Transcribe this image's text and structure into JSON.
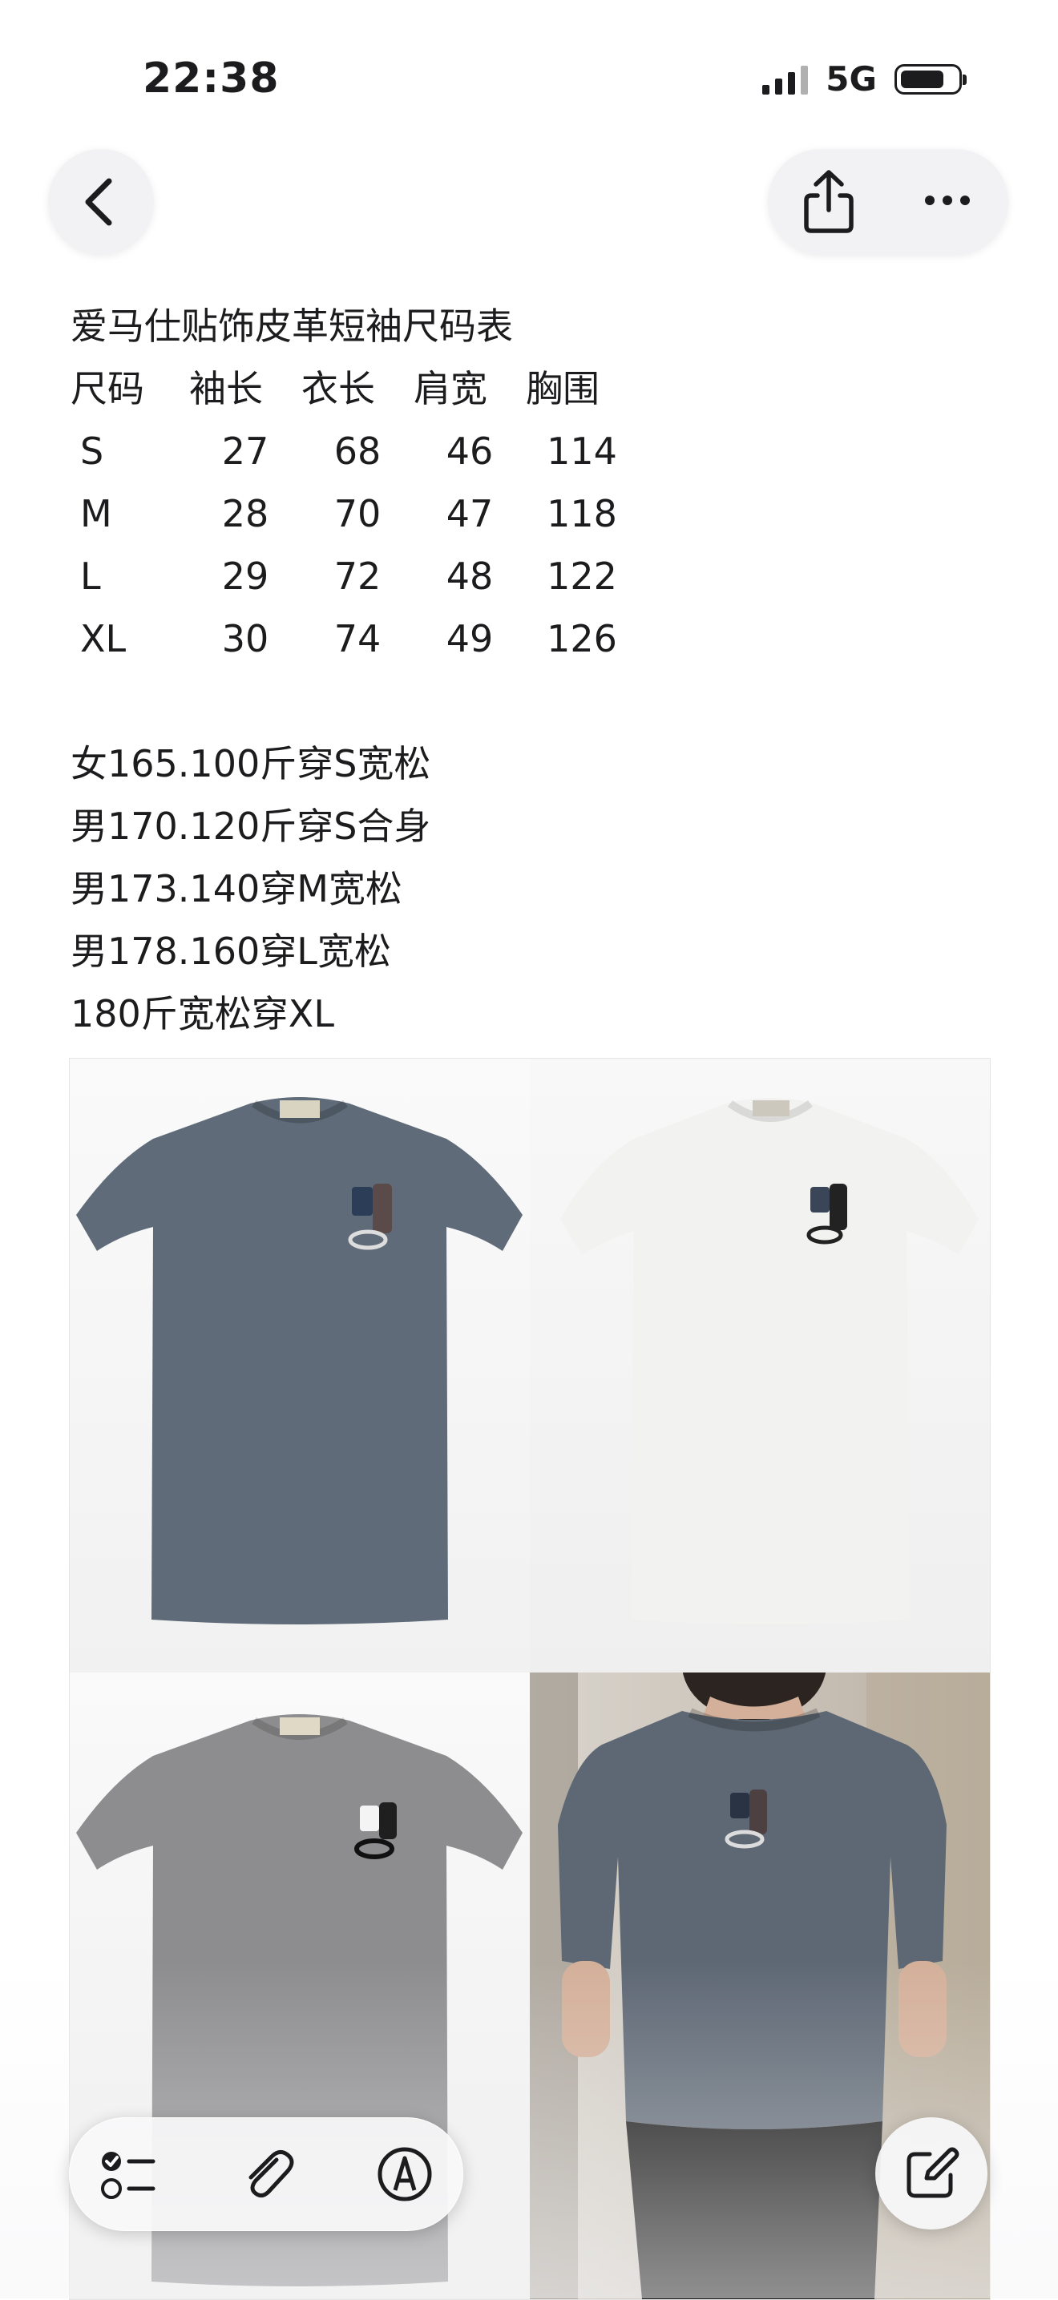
{
  "status_bar": {
    "time": "22:38",
    "network": "5G",
    "battery_level": 0.75
  },
  "toolbar": {
    "back_icon": "chevron-left-icon",
    "share_icon": "share-icon",
    "more_icon": "ellipsis-icon"
  },
  "note": {
    "title": "爱马仕贴饰皮革短袖尺码表",
    "size_table": {
      "headers": [
        "尺码",
        "袖长",
        "衣长",
        "肩宽",
        "胸围"
      ],
      "rows": [
        [
          "S",
          "27",
          "68",
          "46",
          "114"
        ],
        [
          "M",
          "28",
          "70",
          "47",
          "118"
        ],
        [
          "L",
          "29",
          "72",
          "48",
          "122"
        ],
        [
          "XL",
          "30",
          "74",
          "49",
          "126"
        ]
      ]
    },
    "fit_guide": [
      "女165.100斤穿S宽松",
      "男170.120斤穿S合身",
      "男173.140穿M宽松",
      "男178.160穿L宽松",
      "180斤宽松穿XL"
    ]
  },
  "photos": [
    {
      "name": "dark-grey-tshirt",
      "color": "#5f6b78"
    },
    {
      "name": "white-tshirt",
      "color": "#f2f2f0"
    },
    {
      "name": "light-grey-tshirt",
      "color": "#8d8d8f"
    },
    {
      "name": "model-grey-tshirt",
      "color": "#5e6874"
    }
  ],
  "bottom_toolbar": {
    "checklist_icon": "checklist-icon",
    "attach_icon": "paperclip-icon",
    "markup_icon": "markup-pen-icon",
    "compose_icon": "compose-icon"
  }
}
